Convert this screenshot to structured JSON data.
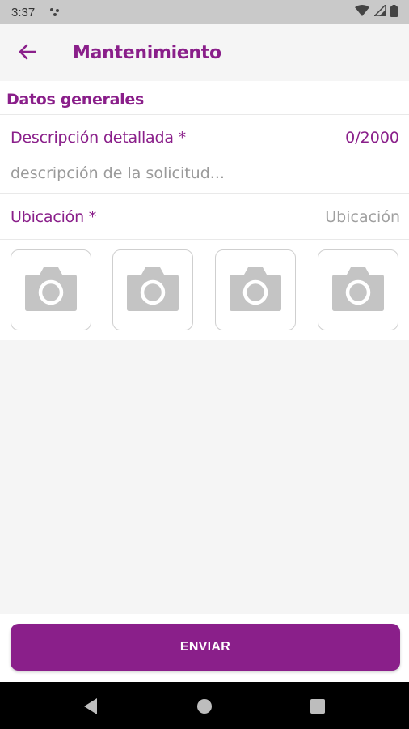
{
  "status_bar": {
    "time": "3:37",
    "icons": [
      "notification-dots-icon",
      "wifi-icon",
      "signal-icon",
      "battery-icon"
    ]
  },
  "app_bar": {
    "title": "Mantenimiento",
    "back_icon": "arrow-left-icon"
  },
  "form": {
    "section_title": "Datos generales",
    "description": {
      "label": "Descripción detallada *",
      "counter": "0/2000",
      "value": "",
      "placeholder": "descripción de la solicitud..."
    },
    "location": {
      "label": "Ubicación *",
      "value": "Ubicación"
    },
    "photos": [
      {
        "icon": "camera-icon"
      },
      {
        "icon": "camera-icon"
      },
      {
        "icon": "camera-icon"
      },
      {
        "icon": "camera-icon"
      }
    ]
  },
  "footer": {
    "submit_label": "ENVIAR"
  },
  "nav_bar": {
    "buttons": [
      "back-triangle-icon",
      "home-circle-icon",
      "recents-square-icon"
    ]
  },
  "colors": {
    "accent": "#8a1f8a",
    "status_bar": "#c9c9c9",
    "background": "#f5f5f5",
    "placeholder": "#9a9a9a"
  }
}
